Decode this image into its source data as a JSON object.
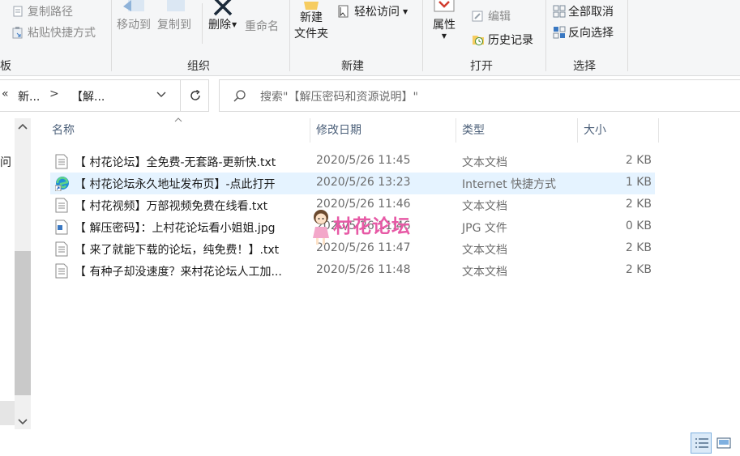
{
  "ribbon": {
    "clipboard": {
      "copy_path": "复制路径",
      "paste_shortcut": "粘贴快捷方式",
      "partial_label": "板"
    },
    "organize": {
      "label": "组织",
      "move_to": "移动到",
      "copy_to": "复制到",
      "delete": "删除",
      "rename": "重命名"
    },
    "new": {
      "label": "新建",
      "new_folder_line1": "新建",
      "new_folder_line2": "文件夹",
      "easy_access": "轻松访问"
    },
    "open": {
      "label": "打开",
      "properties": "属性",
      "edit": "编辑",
      "history": "历史记录"
    },
    "select": {
      "label": "选择",
      "select_none": "全部取消",
      "invert_selection": "反向选择"
    }
  },
  "address": {
    "overflow": "«",
    "crumb1": "新...",
    "separator": ">",
    "crumb2": "【解...",
    "search_placeholder": "搜索\"【解压密码和资源说明】\""
  },
  "nav": {
    "partial_item": "问"
  },
  "columns": {
    "name": "名称",
    "date": "修改日期",
    "type": "类型",
    "size": "大小"
  },
  "files": [
    {
      "name": "【 村花论坛】全免费-无套路-更新快.txt",
      "date": "2020/5/26 11:45",
      "type": "文本文档",
      "size": "2 KB",
      "icon": "text-file-icon"
    },
    {
      "name": "【 村花论坛永久地址发布页】-点此打开",
      "date": "2020/5/26 13:23",
      "type": "Internet 快捷方式",
      "size": "1 KB",
      "icon": "edge-shortcut-icon"
    },
    {
      "name": "【 村花视频】万部视频免费在线看.txt",
      "date": "2020/5/26 11:46",
      "type": "文本文档",
      "size": "2 KB",
      "icon": "text-file-icon"
    },
    {
      "name": "【 解压密码】：上村花论坛看小姐姐.jpg",
      "date": "2020/5/26 11:46",
      "type": "JPG 文件",
      "size": "0 KB",
      "icon": "image-file-icon"
    },
    {
      "name": "【 来了就能下载的论坛，纯免费！】.txt",
      "date": "2020/5/26 11:47",
      "type": "文本文档",
      "size": "2 KB",
      "icon": "text-file-icon"
    },
    {
      "name": "【 有种子却没速度？来村花论坛人工加...",
      "date": "2020/5/26 11:48",
      "type": "文本文档",
      "size": "2 KB",
      "icon": "text-file-icon"
    }
  ],
  "watermark": "村花论坛",
  "colors": {
    "selection": "#e5f3ff",
    "watermark": "#e75aa6",
    "header_text": "#4c607a"
  }
}
